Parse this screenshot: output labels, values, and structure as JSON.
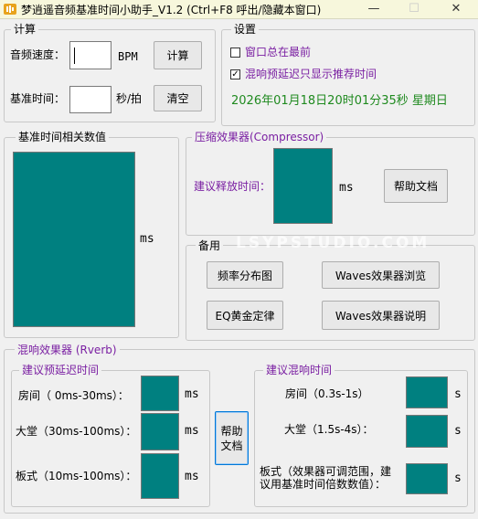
{
  "window": {
    "title": "梦逍遥音频基准时间小助手_V1.2   (Ctrl+F8 呼出/隐藏本窗口)",
    "minimize_glyph": "—",
    "maximize_glyph": "☐",
    "close_glyph": "✕"
  },
  "calc": {
    "legend": "计算",
    "speed_label": "音频速度：",
    "speed_value": "",
    "speed_unit": "BPM",
    "calc_button": "计算",
    "base_label": "基准时间：",
    "base_value": "",
    "base_unit": "秒/拍",
    "clear_button": "清空"
  },
  "settings": {
    "legend": "设置",
    "always_on_top_label": "窗口总在最前",
    "always_on_top_checked": false,
    "reverb_only_label": "混响预延迟只显示推荐时间",
    "reverb_only_checked": true,
    "datetime": "2026年01月18日20时01分35秒  星期日"
  },
  "base_values": {
    "legend": "基准时间相关数值",
    "unit": "ms"
  },
  "compressor": {
    "legend": "压缩效果器(Compressor)",
    "release_label": "建议释放时间：",
    "unit": "ms",
    "help_button": "帮助文档"
  },
  "spare": {
    "legend": "备用",
    "buttons": {
      "freq": "频率分布图",
      "waves_browse": "Waves效果器浏览",
      "eq": "EQ黄金定律",
      "waves_desc": "Waves效果器说明"
    }
  },
  "watermark": "LSYPSTUDIO.COM",
  "reverb": {
    "legend": "混响效果器 (Rverb)",
    "predelay": {
      "legend": "建议预延迟时间",
      "room": "房间（ 0ms-30ms）：",
      "hall": "大堂（30ms-100ms）：",
      "plate": "板式（10ms-100ms）：",
      "unit": "ms"
    },
    "help_button_line1": "帮助",
    "help_button_line2": "文档",
    "decay": {
      "legend": "建议混响时间",
      "room": "房间（0.3s-1s）",
      "hall": "大堂（1.5s-4s）：",
      "plate_line1": "板式（效果器可调范围，建",
      "plate_line2": "议用基准时间倍数数值）：",
      "unit": "s"
    }
  }
}
